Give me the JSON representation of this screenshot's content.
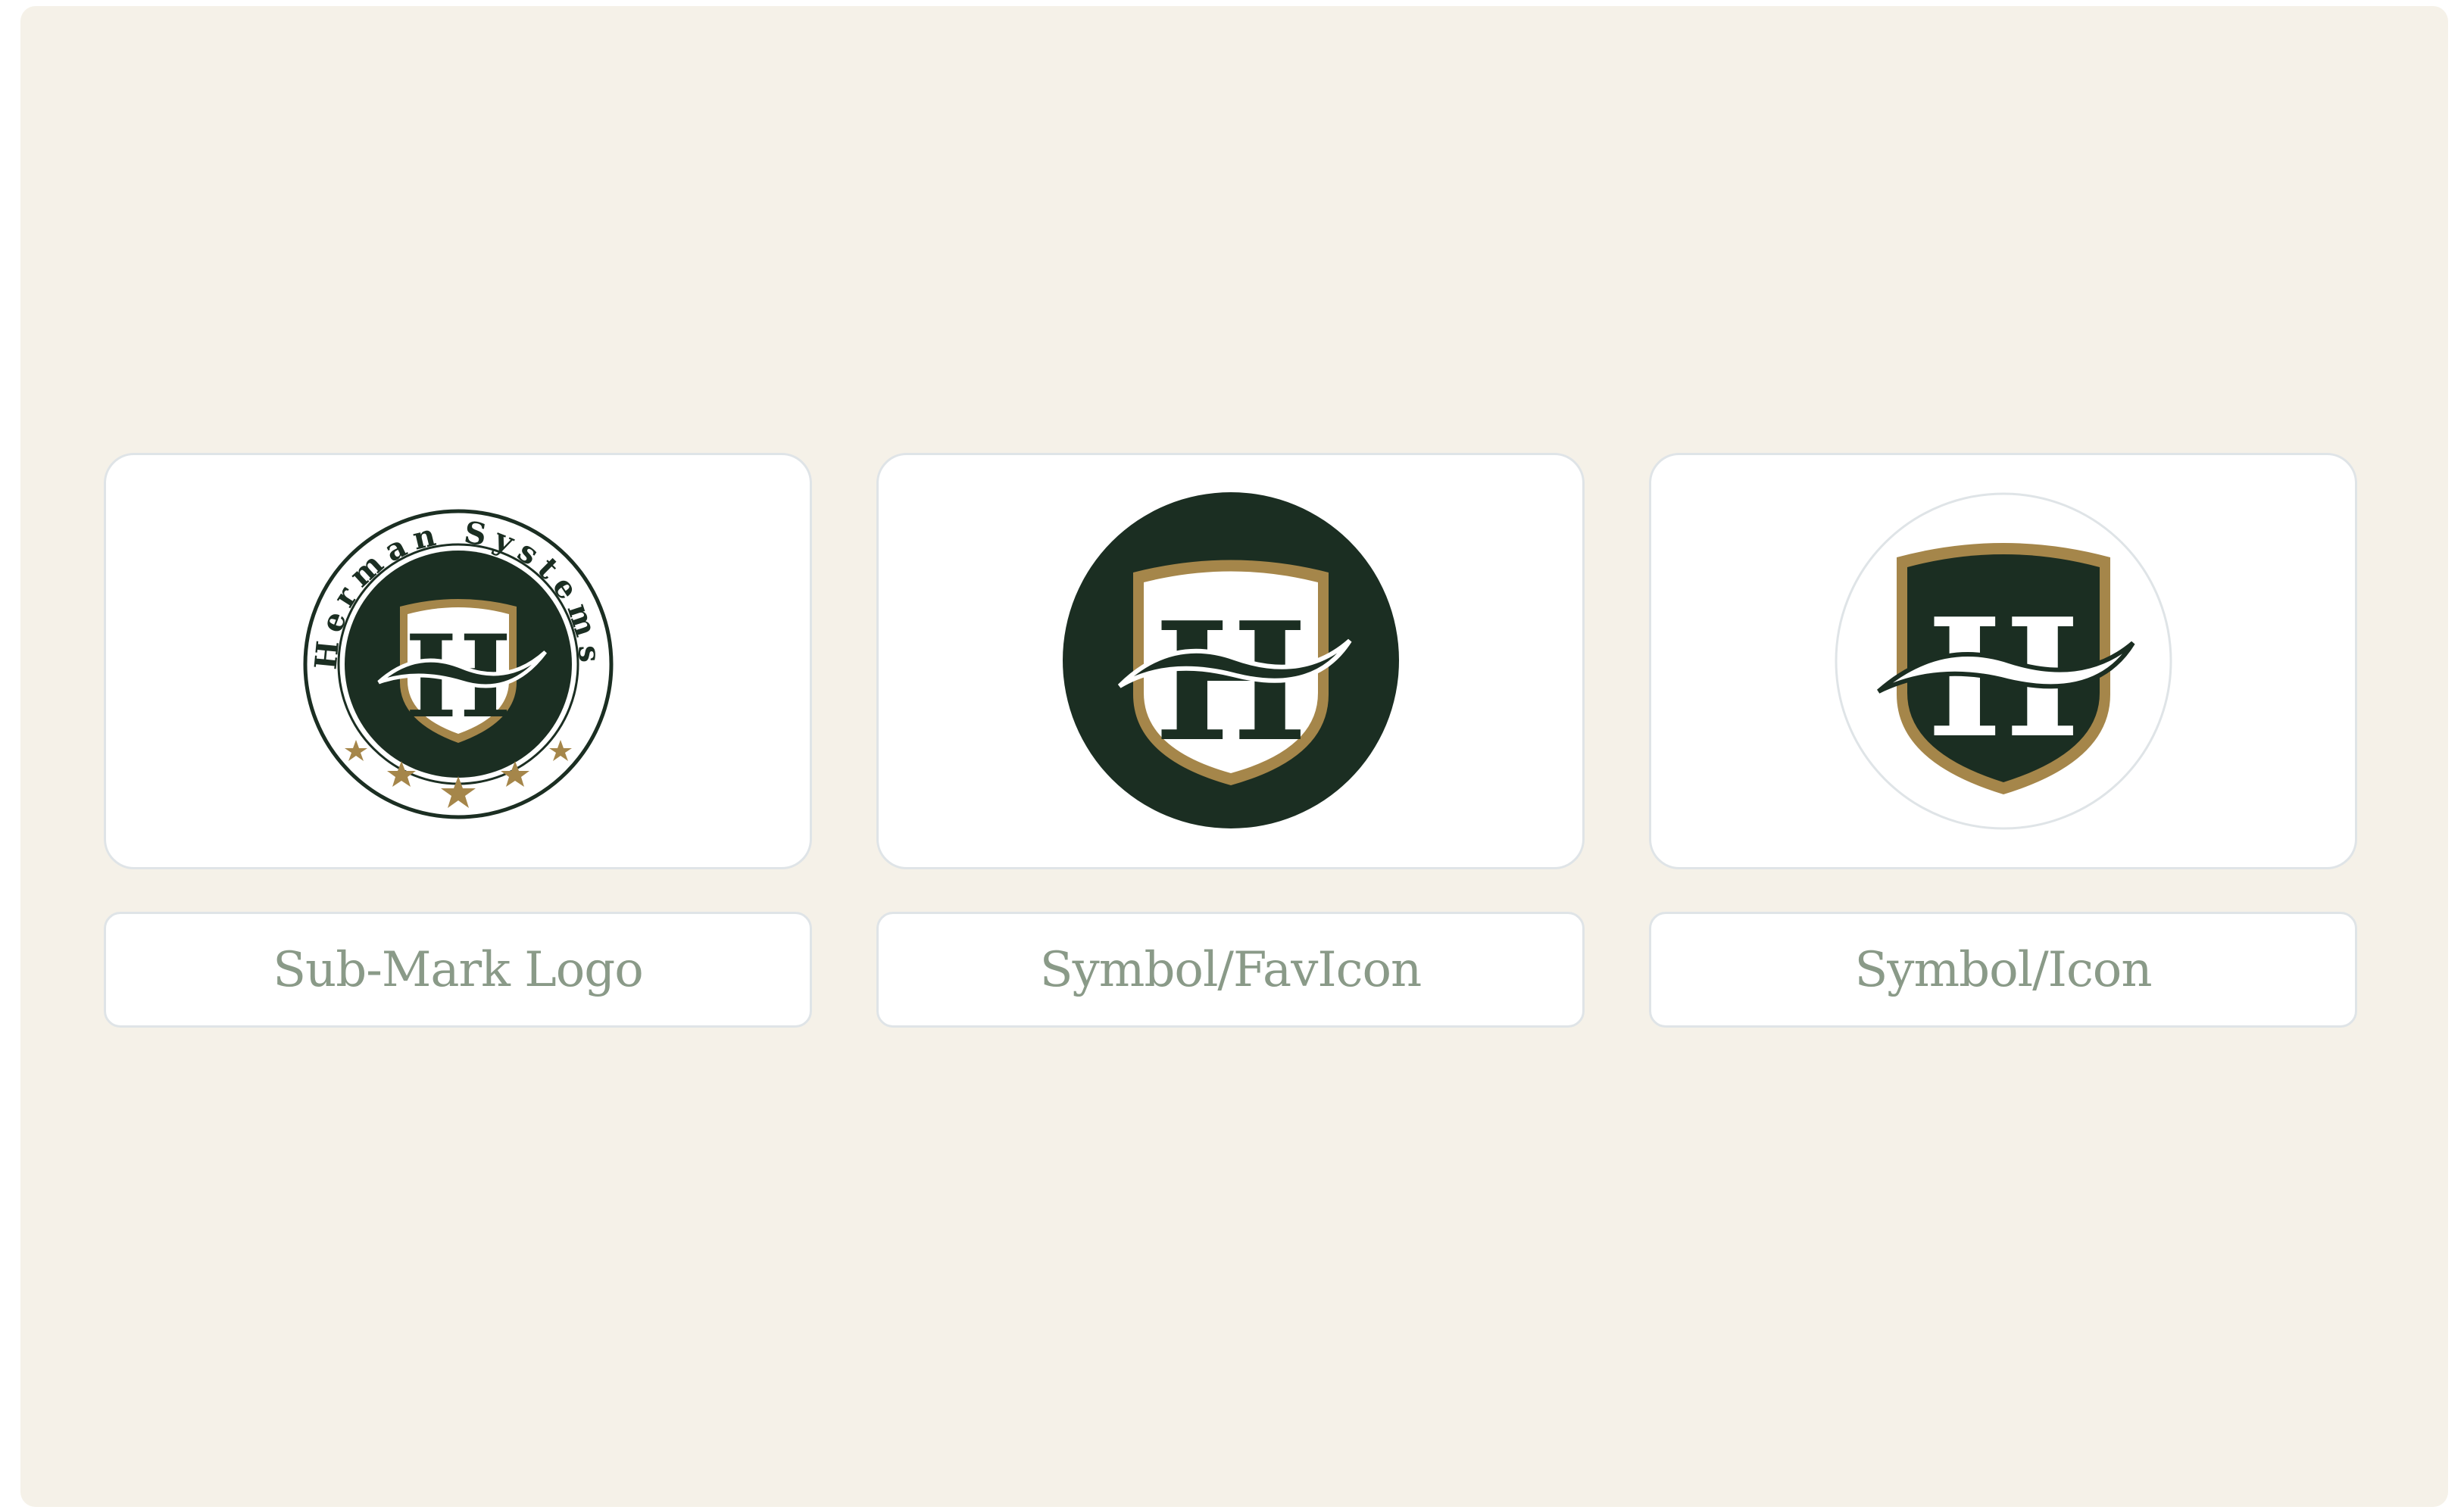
{
  "brand": {
    "name": "Herman Systems",
    "monogram": "H",
    "colors": {
      "background": "#f5f1e8",
      "card": "#ffffff",
      "border": "#dfe4e7",
      "dark_green": "#1b2e22",
      "gold": "#a5864a",
      "label_text": "#8a9a88"
    }
  },
  "items": [
    {
      "label": "Sub-Mark Logo",
      "icon": "sub-mark-logo-icon"
    },
    {
      "label": "Symbol/FavIcon",
      "icon": "symbol-favicon-icon"
    },
    {
      "label": "Symbol/Icon",
      "icon": "symbol-icon"
    }
  ]
}
